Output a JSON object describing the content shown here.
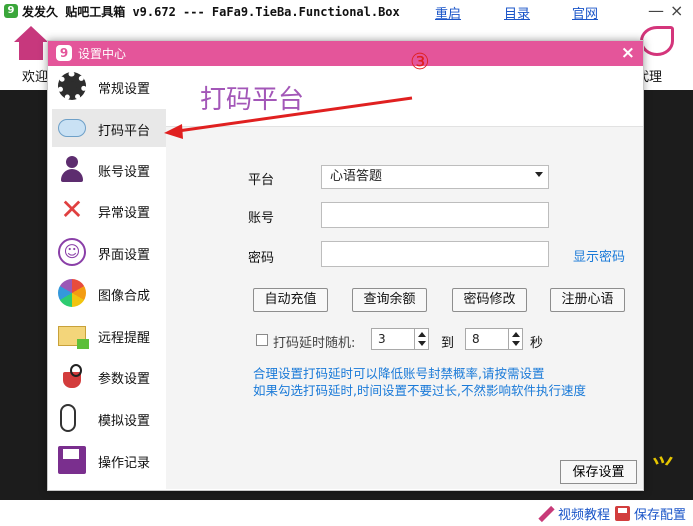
{
  "app": {
    "title": "发发久 贴吧工具箱 v9.672 --- FaFa9.TieBa.Functional.Box",
    "links": [
      "重启",
      "目录",
      "官网"
    ],
    "window_controls": [
      "—",
      "×"
    ],
    "toolbar": {
      "home_label": "欢迎",
      "proxy_label": "代理"
    },
    "footer": {
      "video_tutorial": "视频教程",
      "save_config": "保存配置"
    }
  },
  "dialog": {
    "title": "设置中心",
    "close": "×",
    "logo_char": "9",
    "nav": [
      {
        "label": "常规设置",
        "icon": "gear-icon"
      },
      {
        "label": "打码平台",
        "icon": "cloud-icon",
        "active": true
      },
      {
        "label": "账号设置",
        "icon": "user-icon"
      },
      {
        "label": "异常设置",
        "icon": "x-mark-icon"
      },
      {
        "label": "界面设置",
        "icon": "smiley-icon"
      },
      {
        "label": "图像合成",
        "icon": "flower-icon"
      },
      {
        "label": "远程提醒",
        "icon": "mail-icon"
      },
      {
        "label": "参数设置",
        "icon": "bag-icon"
      },
      {
        "label": "模拟设置",
        "icon": "mouse-icon"
      },
      {
        "label": "操作记录",
        "icon": "floppy-icon"
      }
    ],
    "content_title": "打码平台",
    "annotation": "③",
    "form": {
      "platform_label": "平台",
      "platform_value": "心语答题",
      "account_label": "账号",
      "account_value": "",
      "password_label": "密码",
      "password_value": "",
      "show_password": "显示密码"
    },
    "buttons": [
      "自动充值",
      "查询余额",
      "密码修改",
      "注册心语"
    ],
    "delay": {
      "checkbox_label": "打码延时随机:",
      "checked": false,
      "from": "3",
      "to_label": "到",
      "to": "8",
      "unit": "秒"
    },
    "hints": [
      "合理设置打码延时可以降低账号封禁概率,请按需设置",
      "如果勾选打码延时,时间设置不要过长,不然影响软件执行速度"
    ],
    "save_button": "保存设置"
  },
  "colors": {
    "accent_pink": "#e4559a",
    "title_purple": "#a357b8",
    "link_blue": "#1a7ad8",
    "annotation_red": "#e02020"
  }
}
